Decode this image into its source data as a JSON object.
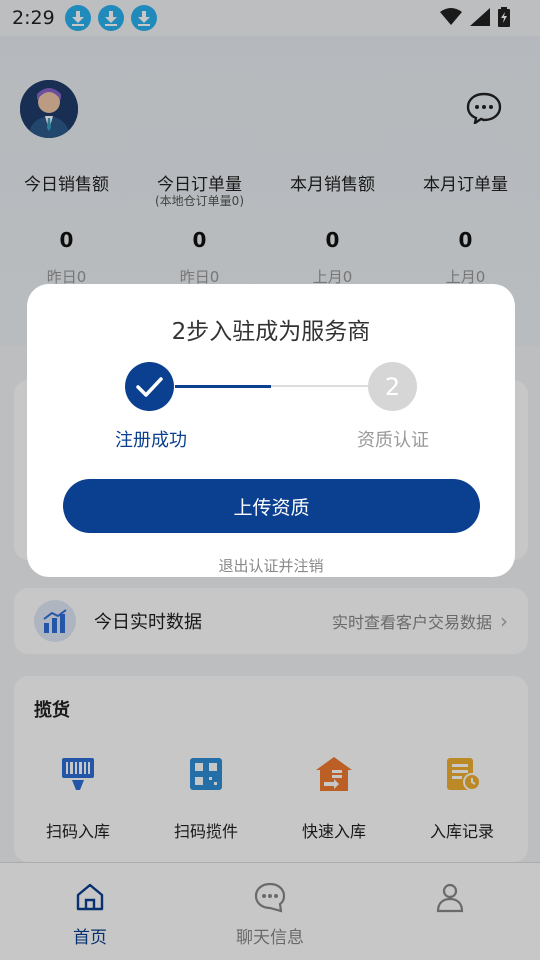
{
  "status_bar": {
    "time": "2:29",
    "download_icons": [
      "download-icon",
      "download-icon",
      "download-icon"
    ],
    "right_icons": [
      "wifi-icon",
      "signal-icon",
      "battery-icon"
    ]
  },
  "header": {
    "avatar": "avatar",
    "chat_icon": "chat-bubble-icon",
    "stats": [
      {
        "label": "今日销售额",
        "sub": "",
        "value": "0",
        "prev": "昨日0"
      },
      {
        "label": "今日订单量",
        "sub": "(本地仓订单量0)",
        "value": "0",
        "prev": "昨日0"
      },
      {
        "label": "本月销售额",
        "sub": "",
        "value": "0",
        "prev": "上月0"
      },
      {
        "label": "本月订单量",
        "sub": "",
        "value": "0",
        "prev": "上月0"
      }
    ]
  },
  "realtime": {
    "title": "今日实时数据",
    "link": "实时查看客户交易数据",
    "icon": "bar-chart-icon"
  },
  "goods": {
    "title": "揽货",
    "items": [
      {
        "label": "扫码入库",
        "icon": "barcode-scan-icon"
      },
      {
        "label": "扫码揽件",
        "icon": "qrcode-box-icon"
      },
      {
        "label": "快速入库",
        "icon": "warehouse-icon"
      },
      {
        "label": "入库记录",
        "icon": "record-list-icon"
      }
    ]
  },
  "bottom_nav": [
    {
      "label": "首页",
      "icon": "home-icon",
      "active": true
    },
    {
      "label": "聊天信息",
      "icon": "chat-icon",
      "active": false
    },
    {
      "label": "",
      "icon": "user-icon",
      "active": false
    }
  ],
  "dialog": {
    "title": "2步入驻成为服务商",
    "steps": [
      {
        "label": "注册成功",
        "status": "done"
      },
      {
        "label": "资质认证",
        "number": "2",
        "status": "pending"
      }
    ],
    "primary_button": "上传资质",
    "secondary_link": "退出认证并注销"
  },
  "colors": {
    "primary": "#0b3f8f",
    "pending": "#d6d6d6",
    "accent_blue": "#2ab2f0",
    "orange": "#f0a030"
  }
}
